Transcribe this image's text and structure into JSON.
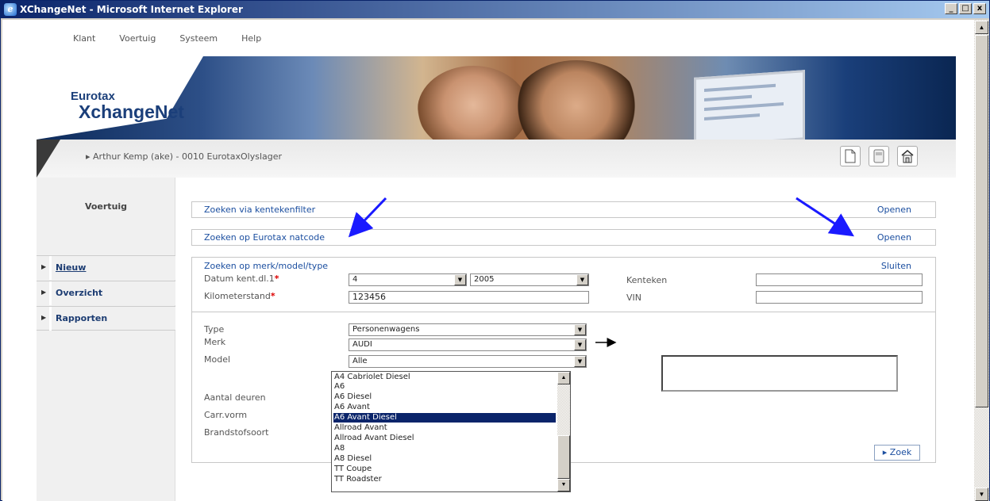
{
  "window": {
    "title": "XChangeNet - Microsoft Internet Explorer",
    "min": "_",
    "max": "□",
    "close": "x"
  },
  "menu": {
    "items": [
      "Klant",
      "Voertuig",
      "Systeem",
      "Help"
    ]
  },
  "banner": {
    "brand_line1": "Eurotax",
    "brand_line2": "XchangeNet"
  },
  "userbar": {
    "user": "▸ Arthur Kemp (ake) - 0010 EurotaxOlyslager"
  },
  "sidebar": {
    "section": "Voertuig",
    "items": [
      {
        "label": "Nieuw"
      },
      {
        "label": "Overzicht"
      },
      {
        "label": "Rapporten"
      }
    ]
  },
  "panels": {
    "kenteken": {
      "title": "Zoeken via kentekenfilter",
      "action": "Openen"
    },
    "natcode": {
      "title": "Zoeken op Eurotax natcode",
      "action": "Openen"
    },
    "merk": {
      "title": "Zoeken op merk/model/type",
      "action": "Sluiten"
    }
  },
  "form": {
    "datum_label": "Datum kent.dl.1",
    "datum_month": "4",
    "datum_year": "2005",
    "km_label": "Kilometerstand",
    "km_value": "123456",
    "kenteken_label": "Kenteken",
    "kenteken_value": "",
    "vin_label": "VIN",
    "vin_value": "",
    "type_label": "Type",
    "type_value": "Personenwagens",
    "merk_label": "Merk",
    "merk_value": "AUDI",
    "model_label": "Model",
    "model_value": "Alle",
    "deuren_label": "Aantal deuren",
    "carr_label": "Carr.vorm",
    "brandstof_label": "Brandstofsoort",
    "required_mark": "*"
  },
  "model_dropdown": {
    "options": [
      "A4 Cabriolet Diesel",
      "A6",
      "A6 Diesel",
      "A6 Avant",
      "A6 Avant Diesel",
      "Allroad Avant",
      "Allroad Avant Diesel",
      "A8",
      "A8 Diesel",
      "TT Coupe",
      "TT Roadster"
    ],
    "selected": "A6 Avant Diesel"
  },
  "buttons": {
    "zoek": "▸ Zoek"
  },
  "colors": {
    "link": "#1c4fa0",
    "annotation_arrow": "#1a1aff",
    "selection": "#0a246a"
  },
  "icons": [
    "new-document-icon",
    "save-icon",
    "home-icon",
    "ie-icon"
  ]
}
